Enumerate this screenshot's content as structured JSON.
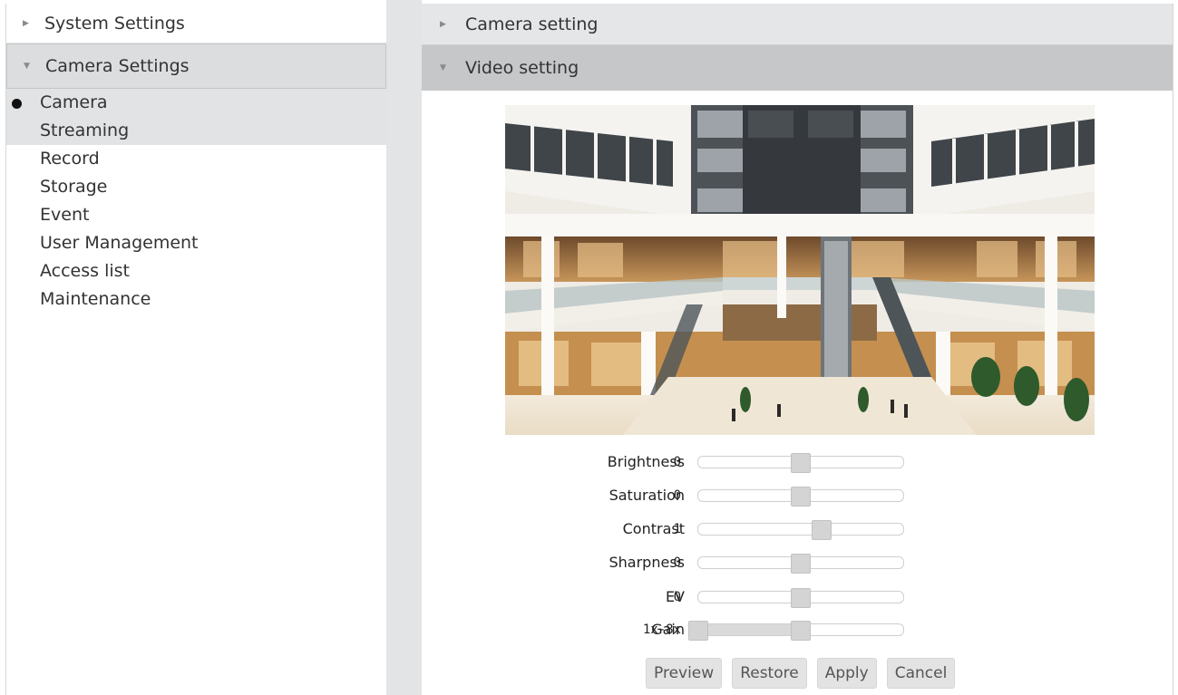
{
  "sidebar": {
    "system_settings": "System Settings",
    "camera_settings": "Camera Settings",
    "items": [
      {
        "label": "Camera"
      },
      {
        "label": "Streaming"
      },
      {
        "label": "Record"
      },
      {
        "label": "Storage"
      },
      {
        "label": "Event"
      },
      {
        "label": "User Management"
      },
      {
        "label": "Access list"
      },
      {
        "label": "Maintenance"
      }
    ]
  },
  "panel": {
    "camera_setting": "Camera setting",
    "video_setting": "Video setting"
  },
  "controls": [
    {
      "label": "Brightness",
      "value": "0",
      "position": 0.5
    },
    {
      "label": "Saturation",
      "value": "0",
      "position": 0.5
    },
    {
      "label": "Contrast",
      "value": "1",
      "position": 0.6
    },
    {
      "label": "Sharpness",
      "value": "0",
      "position": 0.5
    },
    {
      "label": "EV",
      "value": "0",
      "position": 0.5
    },
    {
      "label": "Gain",
      "value": "1x-8x",
      "range": [
        0.0,
        0.5
      ]
    }
  ],
  "buttons": {
    "preview": "Preview",
    "restore": "Restore",
    "apply": "Apply",
    "cancel": "Cancel"
  },
  "icons": {
    "collapsed": "caret-right-icon",
    "expanded": "caret-down-icon",
    "selected": "bullet-icon"
  },
  "colors": {
    "expanded_header": "#c6c7c9",
    "selected_item": "#e2e3e5",
    "gutter": "#e2e4e6"
  }
}
